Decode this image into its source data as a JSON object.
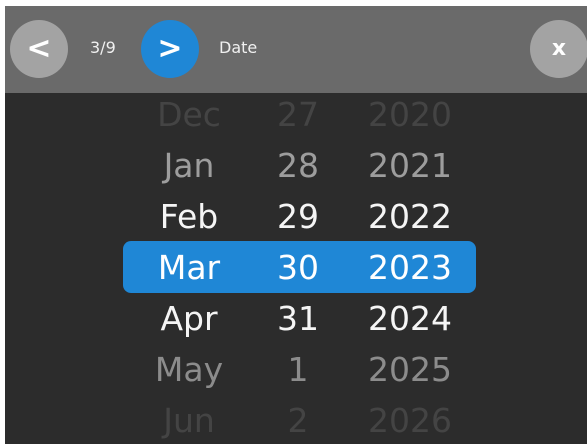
{
  "toolbar": {
    "prev_icon": "chevron-left-icon",
    "prev_glyph": "<",
    "counter": "3/9",
    "next_icon": "chevron-right-icon",
    "next_glyph": ">",
    "title": "Date",
    "close_icon": "close-icon",
    "close_glyph": "x"
  },
  "picker": {
    "selected_index": 3,
    "highlight_color": "#1f87d6",
    "months": [
      "Dec",
      "Jan",
      "Feb",
      "Mar",
      "Apr",
      "May",
      "Jun"
    ],
    "days": [
      "27",
      "28",
      "29",
      "30",
      "31",
      "1",
      "2"
    ],
    "years": [
      "2020",
      "2021",
      "2022",
      "2023",
      "2024",
      "2025",
      "2026"
    ]
  },
  "colors": {
    "toolbar_bg": "#6a6a6a",
    "panel_bg": "#2c2c2c",
    "accent": "#1f87d6",
    "neutral_button": "#a3a3a3"
  }
}
